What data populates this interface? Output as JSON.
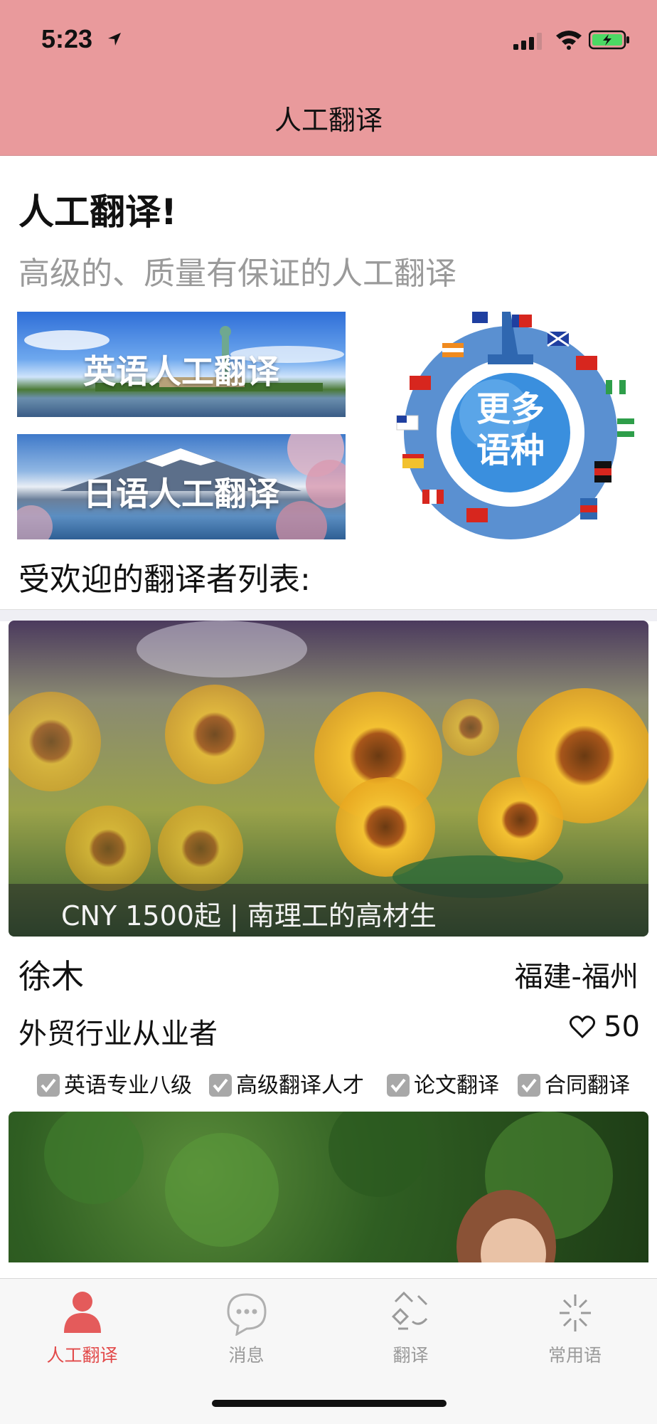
{
  "status": {
    "time": "5:23"
  },
  "nav": {
    "title": "人工翻译"
  },
  "header": {
    "headline": "人工翻译!",
    "subtitle": "高级的、质量有保证的人工翻译"
  },
  "banners": {
    "english": "英语人工翻译",
    "japanese": "日语人工翻译",
    "more_line1": "更多",
    "more_line2": "语种"
  },
  "section_title": "受欢迎的翻译者列表:",
  "translators": [
    {
      "caption": "CNY 1500起 | 南理工的高材生",
      "name": "徐木",
      "location": "福建-福州",
      "role": "外贸行业从业者",
      "likes": "50",
      "tags": [
        "英语专业八级",
        "高级翻译人才",
        "论文翻译",
        "合同翻译"
      ]
    }
  ],
  "tabs": [
    {
      "label": "人工翻译",
      "icon": "person-icon",
      "active": true
    },
    {
      "label": "消息",
      "icon": "chat-bubble-icon",
      "active": false
    },
    {
      "label": "翻译",
      "icon": "translate-icon",
      "active": false
    },
    {
      "label": "常用语",
      "icon": "sparkle-icon",
      "active": false
    }
  ],
  "colors": {
    "accent": "#e99a9c",
    "active_tab": "#e24a4a",
    "inactive_tab": "#9a9a9a"
  }
}
